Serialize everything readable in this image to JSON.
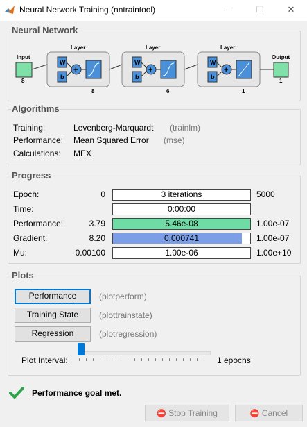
{
  "window": {
    "title": "Neural Network Training (nntraintool)",
    "minimize": "—",
    "maximize": "☐",
    "close": "✕"
  },
  "network": {
    "section_title": "Neural Network",
    "input_label": "Input",
    "input_size": "8",
    "layers": [
      {
        "label": "Layer",
        "size": "8",
        "w": "W",
        "b": "b"
      },
      {
        "label": "Layer",
        "size": "6",
        "w": "W",
        "b": "b"
      },
      {
        "label": "Layer",
        "size": "1",
        "w": "W",
        "b": "b"
      }
    ],
    "output_label": "Output",
    "output_size": "1"
  },
  "algorithms": {
    "section_title": "Algorithms",
    "rows": [
      {
        "label": "Training:",
        "value": "Levenberg-Marquardt",
        "code": "(trainlm)"
      },
      {
        "label": "Performance:",
        "value": "Mean Squared Error",
        "code": "(mse)"
      },
      {
        "label": "Calculations:",
        "value": "MEX",
        "code": ""
      }
    ]
  },
  "progress": {
    "section_title": "Progress",
    "rows": [
      {
        "label": "Epoch:",
        "start": "0",
        "bar_text": "3 iterations",
        "end": "5000",
        "fill": 0,
        "color": "#ffffff"
      },
      {
        "label": "Time:",
        "start": "",
        "bar_text": "0:00:00",
        "end": "",
        "fill": 0,
        "color": "#ffffff"
      },
      {
        "label": "Performance:",
        "start": "3.79",
        "bar_text": "5.46e-08",
        "end": "1.00e-07",
        "fill": 1.0,
        "color": "#6fdca6"
      },
      {
        "label": "Gradient:",
        "start": "8.20",
        "bar_text": "0.000741",
        "end": "1.00e-07",
        "fill": 0.94,
        "color": "#7b9ee6"
      },
      {
        "label": "Mu:",
        "start": "0.00100",
        "bar_text": "1.00e-06",
        "end": "1.00e+10",
        "fill": 0,
        "color": "#ffffff"
      }
    ]
  },
  "plots": {
    "section_title": "Plots",
    "buttons": [
      {
        "label": "Performance",
        "code": "(plotperform)"
      },
      {
        "label": "Training State",
        "code": "(plottrainstate)"
      },
      {
        "label": "Regression",
        "code": "(plotregression)"
      }
    ],
    "interval_label": "Plot Interval:",
    "interval_value": "1 epochs",
    "interval_fraction": 0.0
  },
  "status": {
    "message": "Performance goal met."
  },
  "footer": {
    "stop_training": "Stop Training",
    "cancel": "Cancel"
  },
  "colors": {
    "accent": "#0078d7",
    "node_green": "#7fe0a8",
    "layer_bg": "#e6e6e6",
    "check": "#2fa44f"
  }
}
